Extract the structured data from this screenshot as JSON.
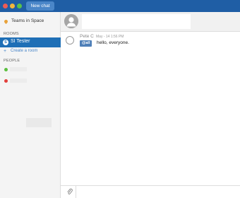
{
  "titlebar": {
    "new_chat_label": "New chat"
  },
  "sidebar": {
    "team_name": "Teams in Space",
    "rooms_label": "ROOMS",
    "active_room": {
      "badge": "S",
      "name": "SI Tester"
    },
    "create_room_label": "Create a room",
    "people_label": "PEOPLE",
    "people": [
      {
        "status": "online"
      },
      {
        "status": "busy"
      }
    ]
  },
  "conversation": {
    "messages": [
      {
        "author": "Pete C",
        "time": "May - 14 1:56 PM",
        "tag": "@all",
        "text": "hello, everyone."
      }
    ]
  },
  "composer": {
    "placeholder": ""
  },
  "colors": {
    "titlebar": "#1f5ea5",
    "active_room": "#1f6fb6",
    "accent": "#4a86c8",
    "online": "#5bbf3f",
    "busy": "#e2403c"
  }
}
